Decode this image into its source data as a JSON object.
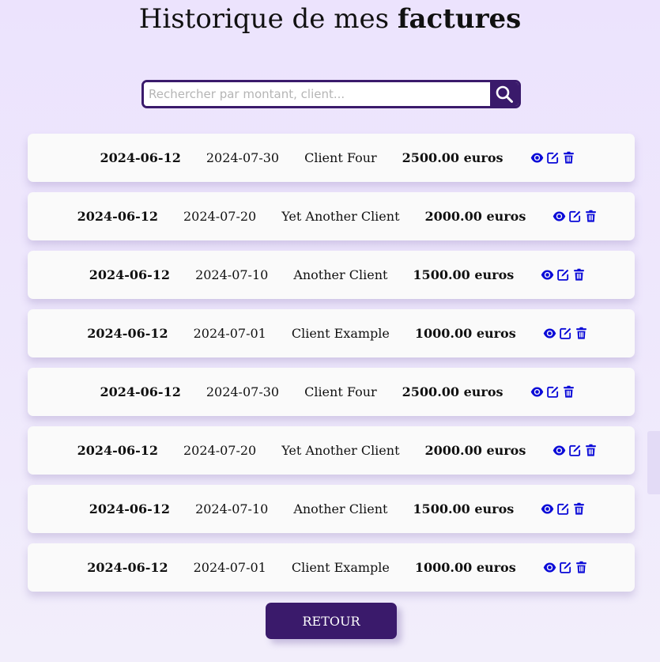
{
  "header": {
    "title_prefix": "Historique de mes",
    "title_bold": "factures"
  },
  "search": {
    "placeholder": "Rechercher par montant, client..."
  },
  "invoices": [
    {
      "date_emission": "2024-06-12",
      "date_echeance": "2024-07-30",
      "client": "Client Four",
      "amount": "2500.00 euros"
    },
    {
      "date_emission": "2024-06-12",
      "date_echeance": "2024-07-20",
      "client": "Yet Another Client",
      "amount": "2000.00 euros"
    },
    {
      "date_emission": "2024-06-12",
      "date_echeance": "2024-07-10",
      "client": "Another Client",
      "amount": "1500.00 euros"
    },
    {
      "date_emission": "2024-06-12",
      "date_echeance": "2024-07-01",
      "client": "Client Example",
      "amount": "1000.00 euros"
    },
    {
      "date_emission": "2024-06-12",
      "date_echeance": "2024-07-30",
      "client": "Client Four",
      "amount": "2500.00 euros"
    },
    {
      "date_emission": "2024-06-12",
      "date_echeance": "2024-07-20",
      "client": "Yet Another Client",
      "amount": "2000.00 euros"
    },
    {
      "date_emission": "2024-06-12",
      "date_echeance": "2024-07-10",
      "client": "Another Client",
      "amount": "1500.00 euros"
    },
    {
      "date_emission": "2024-06-12",
      "date_echeance": "2024-07-01",
      "client": "Client Example",
      "amount": "1000.00 euros"
    }
  ],
  "row_actions": [
    "eye-icon",
    "edit-icon",
    "trash-icon"
  ],
  "footer": {
    "back_label": "RETOUR"
  },
  "colors": {
    "primary": "#3a1a6b",
    "action_icons": "#0a0ad8",
    "row_bg": "#fafafa"
  }
}
